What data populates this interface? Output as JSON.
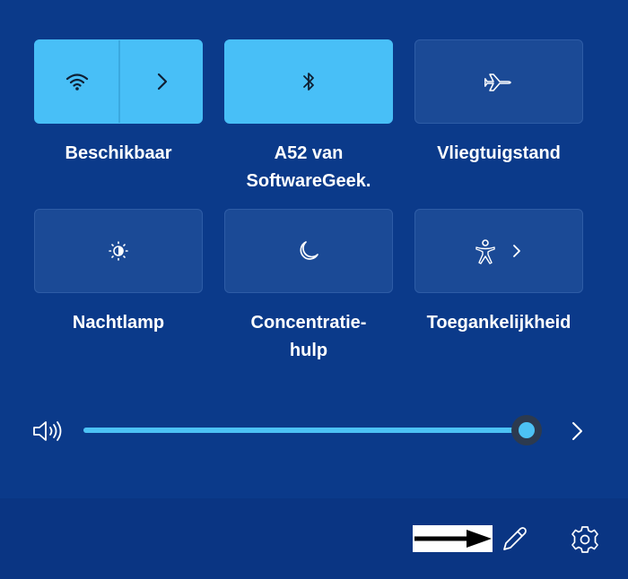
{
  "quick_settings": {
    "tiles": [
      {
        "label_lines": [
          "Beschikbaar"
        ],
        "icon": "wifi-icon",
        "secondary_icon": "chevron-right-icon",
        "active": true
      },
      {
        "label_lines": [
          "A52 van",
          "SoftwareGeek."
        ],
        "icon": "bluetooth-icon",
        "active": true
      },
      {
        "label_lines": [
          "Vliegtuigstand"
        ],
        "icon": "airplane-icon",
        "active": false
      },
      {
        "label_lines": [
          "Nachtlamp"
        ],
        "icon": "night-light-icon",
        "active": false
      },
      {
        "label_lines": [
          "Concentratie-",
          "hulp"
        ],
        "icon": "moon-icon",
        "active": false
      },
      {
        "label_lines": [
          "Toegankelijkheid"
        ],
        "icon": "accessibility-icon",
        "secondary_icon": "chevron-right-icon",
        "active": false
      }
    ]
  },
  "volume": {
    "icon": "speaker-icon",
    "level": 1.0,
    "expand_icon": "chevron-right-icon"
  },
  "footer": {
    "annotation": "arrow-pointer-icon",
    "edit_icon": "pencil-icon",
    "settings_icon": "gear-icon"
  },
  "colors": {
    "background": "#0b3a8a",
    "tile_off": "#1b4a96",
    "tile_on": "#48bff7",
    "accent": "#4cc2f5"
  }
}
